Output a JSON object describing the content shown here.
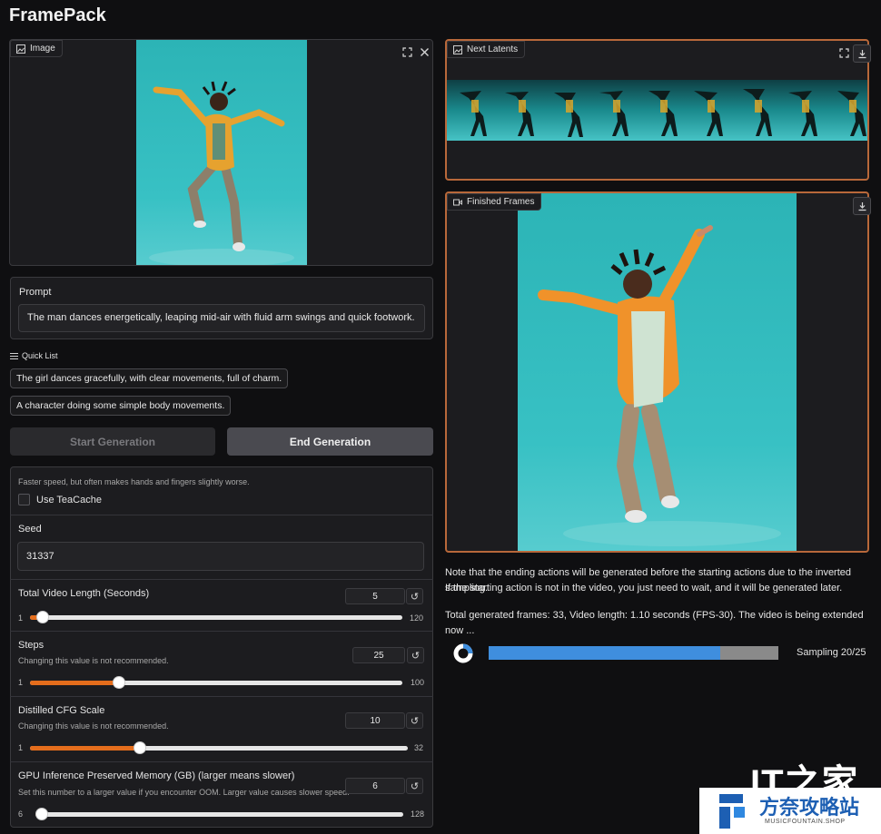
{
  "app": {
    "title": "FramePack"
  },
  "image_panel": {
    "label": "Image",
    "icons": [
      "image-icon",
      "fullscreen-icon",
      "close-icon"
    ]
  },
  "prompt": {
    "label": "Prompt",
    "value": "The man dances energetically, leaping mid-air with fluid arm swings and quick footwork."
  },
  "quick_list": {
    "label": "Quick List",
    "items": [
      "The girl dances gracefully, with clear movements, full of charm.",
      "A character doing some simple body movements."
    ]
  },
  "buttons": {
    "start": "Start Generation",
    "end": "End Generation"
  },
  "teacache": {
    "info": "Faster speed, but often makes hands and fingers slightly worse.",
    "label": "Use TeaCache",
    "checked": false
  },
  "seed": {
    "label": "Seed",
    "value": "31337"
  },
  "sliders": [
    {
      "label": "Total Video Length (Seconds)",
      "info": "",
      "value": "5",
      "min": "1",
      "max": "120",
      "fraction": 0.034
    },
    {
      "label": "Steps",
      "info": "Changing this value is not recommended.",
      "value": "25",
      "min": "1",
      "max": "100",
      "fraction": 0.24
    },
    {
      "label": "Distilled CFG Scale",
      "info": "Changing this value is not recommended.",
      "value": "10",
      "min": "1",
      "max": "32",
      "fraction": 0.29
    },
    {
      "label": "GPU Inference Preserved Memory (GB) (larger means slower)",
      "info": "Set this number to a larger value if you encounter OOM. Larger value causes slower speed.",
      "value": "6",
      "min": "6",
      "max": "128",
      "fraction": 0.0
    }
  ],
  "next_latents": {
    "label": "Next Latents"
  },
  "finished_frames": {
    "label": "Finished Frames"
  },
  "notes": {
    "line1": "Note that the ending actions will be generated before the starting actions due to the inverted sampling.",
    "line2": "If the starting action is not in the video, you just need to wait, and it will be generated later.",
    "status": "Total generated frames: 33, Video length: 1.10 seconds (FPS-30). The video is being extended now ..."
  },
  "progress": {
    "label": "Sampling 20/25",
    "fraction": 0.8
  },
  "watermark": {
    "brand": "IT之家",
    "cn": "方奈攻略站",
    "url": "MUSICFOUNTAIN.SHOP"
  },
  "colors": {
    "accent": "#e46d1c",
    "progress": "#3f8ede",
    "border_active": "#b8683a",
    "background": "#0f0f11"
  }
}
